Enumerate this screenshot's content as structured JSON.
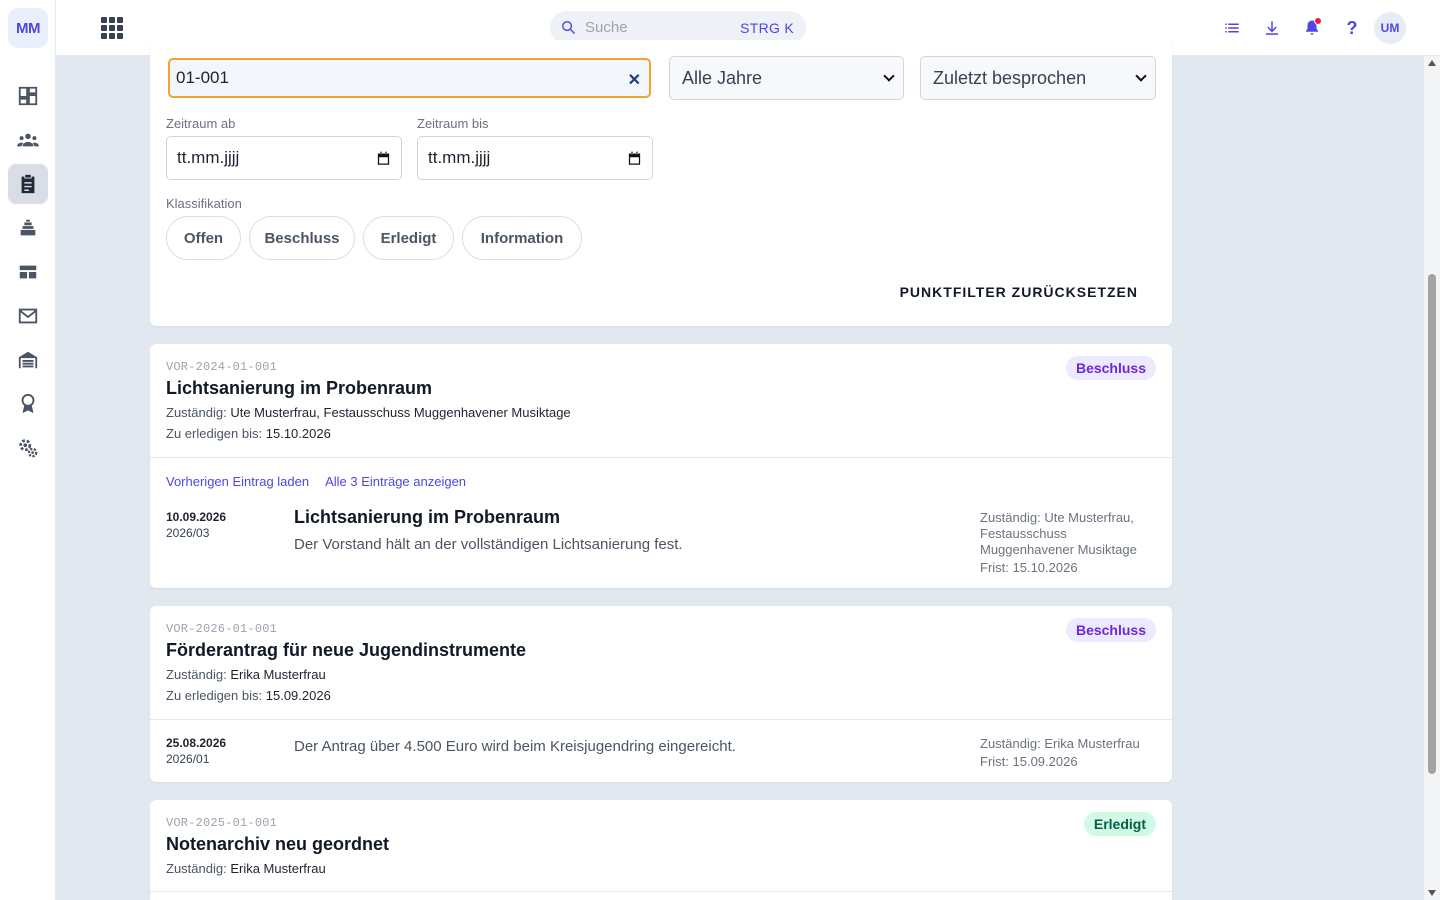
{
  "brand": {
    "initials": "MM"
  },
  "topbar": {
    "search_placeholder": "Suche",
    "search_shortcut": "STRG K",
    "help_label": "?",
    "avatar_initials": "UM"
  },
  "filters": {
    "query_value": "01-001",
    "year_select": "Alle Jahre",
    "sort_select": "Zuletzt besprochen",
    "date_from_label": "Zeitraum ab",
    "date_to_label": "Zeitraum bis",
    "date_placeholder": "tt.mm.jjjj",
    "classification_label": "Klassifikation",
    "chips": [
      "Offen",
      "Beschluss",
      "Erledigt",
      "Information"
    ],
    "reset_label": "PUNKTFILTER ZURÜCKSETZEN"
  },
  "items": [
    {
      "code": "VOR-2024-01-001",
      "title": "Lichtsanierung im Probenraum",
      "status": "Beschluss",
      "responsible_label": "Zuständig:",
      "responsible": "Ute Musterfrau, Festausschuss Muggenhavener Musiktage",
      "due_label": "Zu erledigen bis:",
      "due": "15.10.2026",
      "link_prev": "Vorherigen Eintrag laden",
      "link_all": "Alle 3 Einträge anzeigen",
      "entry": {
        "date": "10.09.2026",
        "session": "2026/03",
        "title": "Lichtsanierung im Probenraum",
        "text": "Der Vorstand hält an der vollständigen Lichtsanierung fest.",
        "side_responsible": "Zuständig: Ute Musterfrau, Festausschuss Muggenhavener Musiktage",
        "side_deadline": "Frist: 15.10.2026"
      }
    },
    {
      "code": "VOR-2026-01-001",
      "title": "Förderantrag für neue Jugendinstrumente",
      "status": "Beschluss",
      "responsible_label": "Zuständig:",
      "responsible": "Erika Musterfrau",
      "due_label": "Zu erledigen bis:",
      "due": "15.09.2026",
      "entry": {
        "date": "25.08.2026",
        "session": "2026/01",
        "text": "Der Antrag über 4.500 Euro wird beim Kreisjugendring eingereicht.",
        "side_responsible": "Zuständig: Erika Musterfrau",
        "side_deadline": "Frist: 15.09.2026"
      }
    },
    {
      "code": "VOR-2025-01-001",
      "title": "Notenarchiv neu geordnet",
      "status": "Erledigt",
      "responsible_label": "Zuständig:",
      "responsible": "Erika Musterfrau"
    }
  ]
}
